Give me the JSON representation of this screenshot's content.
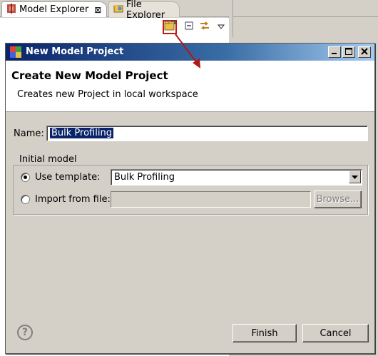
{
  "views": {
    "model_explorer_tab": "Model Explorer",
    "file_explorer_tab": "File Explorer",
    "tab_close_glyph": "⊠"
  },
  "dialog": {
    "title": "New Model Project",
    "heading": "Create New Model Project",
    "description": "Creates new Project in local workspace",
    "name_label": "Name:",
    "name_value": "Bulk Profiling",
    "group_label": "Initial model",
    "use_template_label": "Use template:",
    "template_value": "Bulk Profiling",
    "import_label": "Import from file:",
    "browse_label": "Browse...",
    "finish_label": "Finish",
    "cancel_label": "Cancel",
    "selected_option": "use_template"
  },
  "colors": {
    "title_bar_start": "#0a246a",
    "highlight_red": "#c01818"
  },
  "icons": [
    "model-explorer-icon",
    "file-explorer-icon",
    "new-model-project-icon",
    "collapse-all-icon",
    "link-with-editor-icon",
    "view-menu-icon",
    "help-icon"
  ]
}
